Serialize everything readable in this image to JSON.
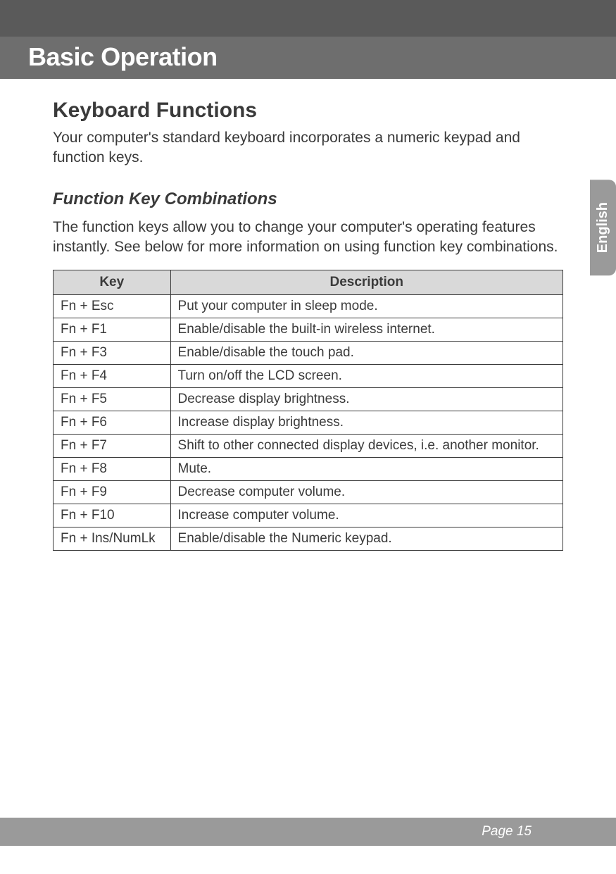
{
  "header": {
    "chapter_title": "Basic Operation"
  },
  "section": {
    "title": "Keyboard Functions",
    "intro": "Your computer's standard keyboard incorporates a numeric keypad and function keys."
  },
  "subsection": {
    "title": "Function Key Combinations",
    "intro": "The function keys allow you to change your computer's operating features instantly. See below for more information on using function key combinations."
  },
  "table": {
    "headers": [
      "Key",
      "Description"
    ],
    "rows": [
      {
        "key": "Fn + Esc",
        "desc": "Put your computer in sleep mode."
      },
      {
        "key": "Fn + F1",
        "desc": "Enable/disable the built-in wireless internet."
      },
      {
        "key": "Fn + F3",
        "desc": "Enable/disable the touch pad."
      },
      {
        "key": "Fn + F4",
        "desc": "Turn on/off the LCD screen."
      },
      {
        "key": "Fn + F5",
        "desc": "Decrease display brightness."
      },
      {
        "key": "Fn + F6",
        "desc": "Increase display brightness."
      },
      {
        "key": "Fn + F7",
        "desc": "Shift to other connected display devices, i.e. another monitor."
      },
      {
        "key": "Fn + F8",
        "desc": "Mute."
      },
      {
        "key": "Fn + F9",
        "desc": "Decrease computer volume."
      },
      {
        "key": "Fn + F10",
        "desc": "Increase computer volume."
      },
      {
        "key": "Fn + Ins/NumLk",
        "desc": "Enable/disable the Numeric keypad."
      }
    ]
  },
  "language_tab": "English",
  "footer": {
    "page_label": "Page 15"
  }
}
